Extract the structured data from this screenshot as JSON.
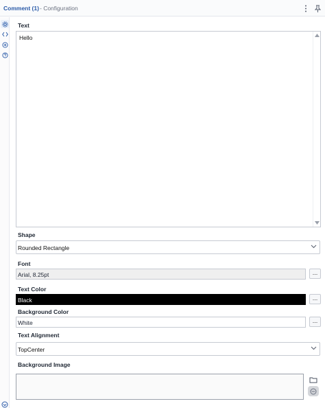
{
  "header": {
    "title": "Comment (1)",
    "subtitle": " - Configuration",
    "icons": [
      "more-vertical-icon",
      "pin-icon"
    ]
  },
  "sidebar": {
    "icons": [
      "gear-icon",
      "code-brackets-icon",
      "annotation-icon",
      "help-icon",
      "collapse-icon"
    ],
    "active": "gear-icon"
  },
  "form": {
    "text_label": "Text",
    "text_value": "Hello",
    "shape_label": "Shape",
    "shape_value": "Rounded Rectangle",
    "font_label": "Font",
    "font_value": "Arial, 8.25pt",
    "text_color_label": "Text Color",
    "text_color_value": "Black",
    "background_color_label": "Background Color",
    "background_color_value": "White",
    "text_alignment_label": "Text Alignment",
    "text_alignment_value": "TopCenter",
    "background_image_label": "Background Image",
    "browse_button_label": "..."
  },
  "colors": {
    "accent": "#2a5aa8",
    "text_color_swatch": "#000000",
    "background_color_swatch": "#ffffff",
    "border": "#c6cad2"
  }
}
